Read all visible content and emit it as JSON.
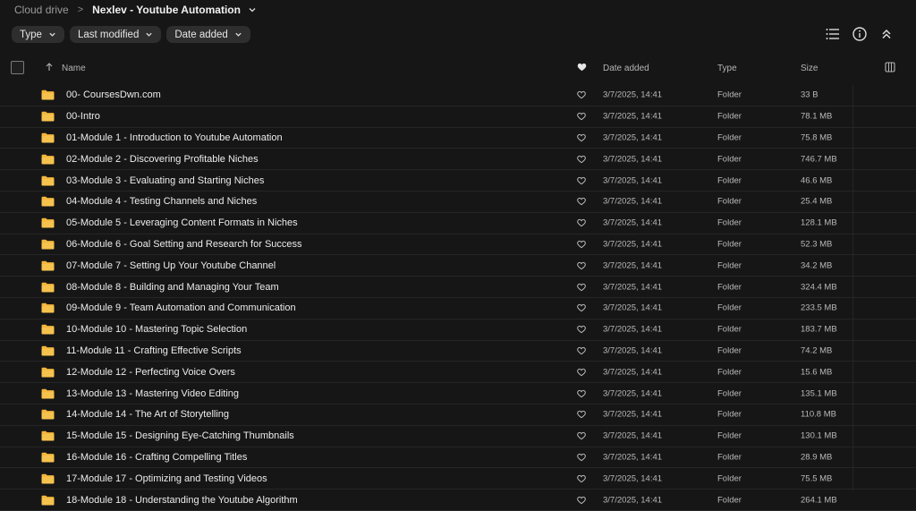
{
  "breadcrumb": {
    "root": "Cloud drive",
    "separator": ">",
    "current": "Nexlev - Youtube Automation"
  },
  "filters": [
    {
      "label": "Type"
    },
    {
      "label": "Last modified"
    },
    {
      "label": "Date added"
    }
  ],
  "toolbar_icons": [
    "list-view-icon",
    "info-icon",
    "collapse-up-icon"
  ],
  "columns": {
    "name": "Name",
    "date": "Date added",
    "type": "Type",
    "size": "Size"
  },
  "colors": {
    "background": "#161616",
    "folder": "#f4b73b",
    "chip": "#2e2e2e"
  },
  "rows": [
    {
      "name": "00- CoursesDwn.com",
      "date": "3/7/2025, 14:41",
      "type": "Folder",
      "size": "33 B"
    },
    {
      "name": "00-Intro",
      "date": "3/7/2025, 14:41",
      "type": "Folder",
      "size": "78.1 MB"
    },
    {
      "name": "01-Module 1 - Introduction to Youtube Automation",
      "date": "3/7/2025, 14:41",
      "type": "Folder",
      "size": "75.8 MB"
    },
    {
      "name": "02-Module 2 - Discovering Profitable Niches",
      "date": "3/7/2025, 14:41",
      "type": "Folder",
      "size": "746.7 MB"
    },
    {
      "name": "03-Module 3 - Evaluating and Starting Niches",
      "date": "3/7/2025, 14:41",
      "type": "Folder",
      "size": "46.6 MB"
    },
    {
      "name": "04-Module 4 - Testing Channels and Niches",
      "date": "3/7/2025, 14:41",
      "type": "Folder",
      "size": "25.4 MB"
    },
    {
      "name": "05-Module 5 - Leveraging Content Formats in Niches",
      "date": "3/7/2025, 14:41",
      "type": "Folder",
      "size": "128.1 MB"
    },
    {
      "name": "06-Module 6 - Goal Setting and Research for Success",
      "date": "3/7/2025, 14:41",
      "type": "Folder",
      "size": "52.3 MB"
    },
    {
      "name": "07-Module 7 - Setting Up Your Youtube Channel",
      "date": "3/7/2025, 14:41",
      "type": "Folder",
      "size": "34.2 MB"
    },
    {
      "name": "08-Module 8 - Building and Managing Your Team",
      "date": "3/7/2025, 14:41",
      "type": "Folder",
      "size": "324.4 MB"
    },
    {
      "name": "09-Module 9 - Team Automation and Communication",
      "date": "3/7/2025, 14:41",
      "type": "Folder",
      "size": "233.5 MB"
    },
    {
      "name": "10-Module 10 - Mastering Topic Selection",
      "date": "3/7/2025, 14:41",
      "type": "Folder",
      "size": "183.7 MB"
    },
    {
      "name": "11-Module 11 - Crafting Effective Scripts",
      "date": "3/7/2025, 14:41",
      "type": "Folder",
      "size": "74.2 MB"
    },
    {
      "name": "12-Module 12 - Perfecting Voice Overs",
      "date": "3/7/2025, 14:41",
      "type": "Folder",
      "size": "15.6 MB"
    },
    {
      "name": "13-Module 13 - Mastering Video Editing",
      "date": "3/7/2025, 14:41",
      "type": "Folder",
      "size": "135.1 MB"
    },
    {
      "name": "14-Module 14 - The Art of Storytelling",
      "date": "3/7/2025, 14:41",
      "type": "Folder",
      "size": "110.8 MB"
    },
    {
      "name": "15-Module 15 - Designing Eye-Catching Thumbnails",
      "date": "3/7/2025, 14:41",
      "type": "Folder",
      "size": "130.1 MB"
    },
    {
      "name": "16-Module 16 - Crafting Compelling Titles",
      "date": "3/7/2025, 14:41",
      "type": "Folder",
      "size": "28.9 MB"
    },
    {
      "name": "17-Module 17 - Optimizing and Testing Videos",
      "date": "3/7/2025, 14:41",
      "type": "Folder",
      "size": "75.5 MB"
    },
    {
      "name": "18-Module 18 - Understanding the Youtube Algorithm",
      "date": "3/7/2025, 14:41",
      "type": "Folder",
      "size": "264.1 MB"
    }
  ]
}
